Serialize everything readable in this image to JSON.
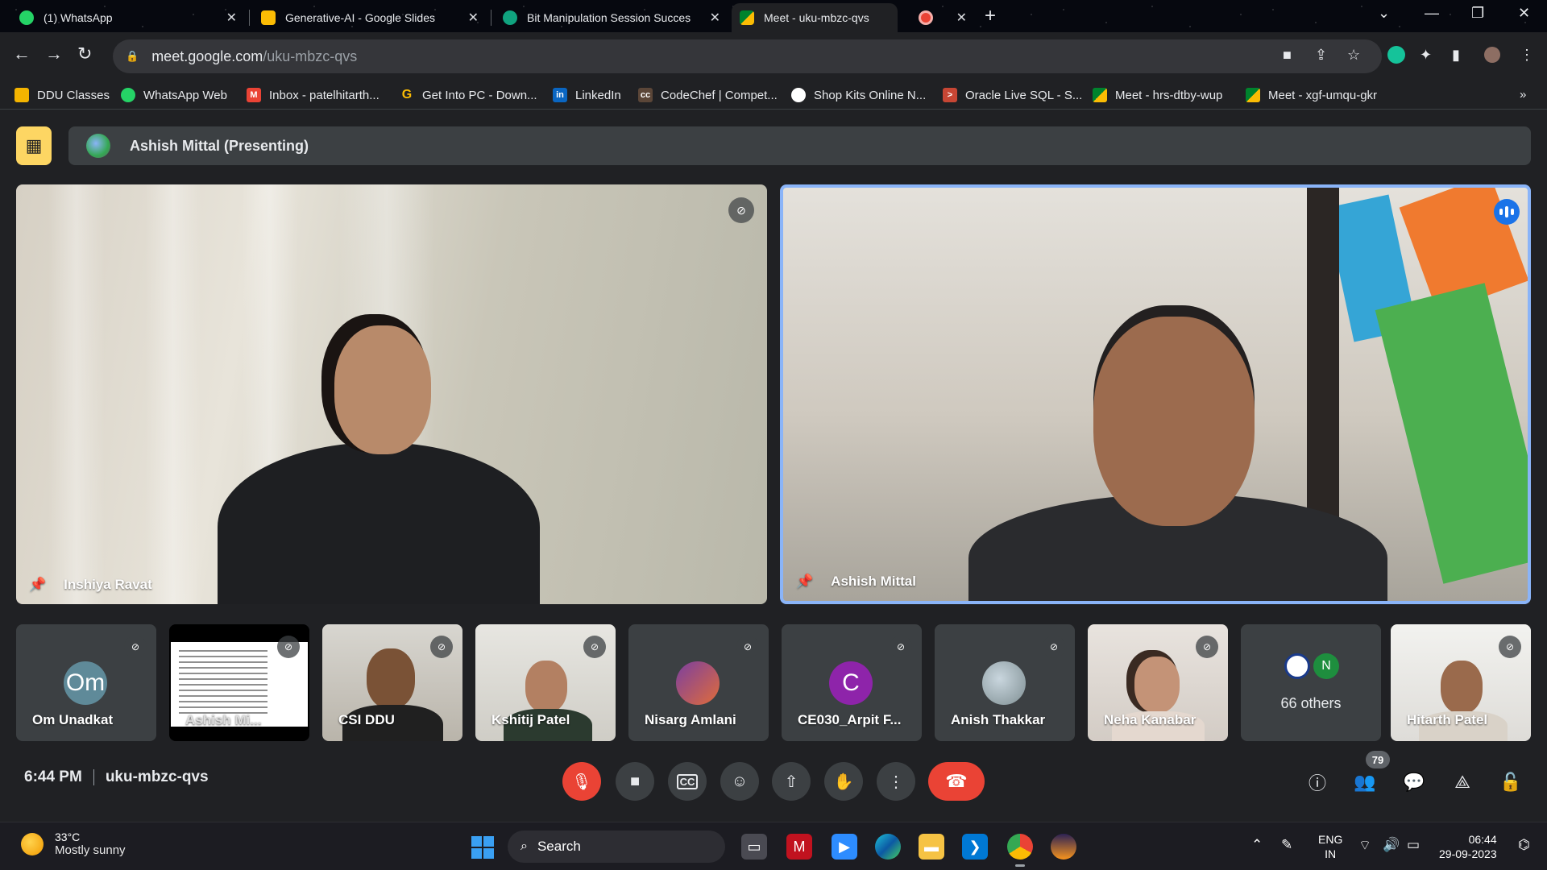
{
  "browser": {
    "tabs": [
      {
        "title": "(1) WhatsApp",
        "color": "#25d366"
      },
      {
        "title": "Generative-AI - Google Slides",
        "color": "#fbbc04"
      },
      {
        "title": "Bit Manipulation Session Succes",
        "color": "#10a37f"
      },
      {
        "title": "Meet - uku-mbzc-qvs",
        "color": "#00832d"
      },
      {
        "title": "",
        "color": "#ea4335"
      }
    ],
    "url_host": "meet.google.com",
    "url_path": "/uku-mbzc-qvs",
    "bookmarks": [
      {
        "label": "DDU Classes",
        "icon": "classroom-icon",
        "color": "#f4b400"
      },
      {
        "label": "WhatsApp Web",
        "icon": "whatsapp-icon",
        "color": "#25d366"
      },
      {
        "label": "Inbox - patelhitarth...",
        "icon": "gmail-icon",
        "color": "#ea4335"
      },
      {
        "label": "Get Into PC - Down...",
        "icon": "getintopc-icon",
        "color": "#fbbc04"
      },
      {
        "label": "LinkedIn",
        "icon": "linkedin-icon",
        "color": "#0a66c2"
      },
      {
        "label": "CodeChef | Compet...",
        "icon": "codechef-icon",
        "color": "#5b4638"
      },
      {
        "label": "Shop Kits Online N...",
        "icon": "shop-icon",
        "color": "#ffffff"
      },
      {
        "label": "Oracle Live SQL - S...",
        "icon": "oracle-icon",
        "color": "#c74634"
      },
      {
        "label": "Meet - hrs-dtby-wup",
        "icon": "meet-icon",
        "color": "#00832d"
      },
      {
        "label": "Meet - xgf-umqu-gkr",
        "icon": "meet-icon",
        "color": "#00832d"
      }
    ]
  },
  "meet": {
    "presenting_label": "Ashish Mittal (Presenting)",
    "main_tiles": [
      {
        "name": "Inshiya Ravat"
      },
      {
        "name": "Ashish Mittal"
      }
    ],
    "thumbs": [
      {
        "name": "Om Unadkat",
        "initials": "Om",
        "avatar_color": "#5f8a99"
      },
      {
        "name": "Ashish Mi..."
      },
      {
        "name": "CSI DDU"
      },
      {
        "name": "Kshitij Patel"
      },
      {
        "name": "Nisarg Amlani"
      },
      {
        "name": "CE030_Arpit F...",
        "initials": "C",
        "avatar_color": "#8e24aa"
      },
      {
        "name": "Anish Thakkar"
      },
      {
        "name": "Neha Kanabar"
      },
      {
        "name": "66 others",
        "initials": "N",
        "avatar_color": "#1e8e3e"
      },
      {
        "name": "Hitarth Patel"
      }
    ],
    "time": "6:44 PM",
    "meeting_code": "uku-mbzc-qvs",
    "participant_count": "79"
  },
  "taskbar": {
    "temperature": "33°C",
    "weather": "Mostly sunny",
    "search_label": "Search",
    "lang_top": "ENG",
    "lang_bottom": "IN",
    "clock_time": "06:44",
    "clock_date": "29-09-2023"
  }
}
